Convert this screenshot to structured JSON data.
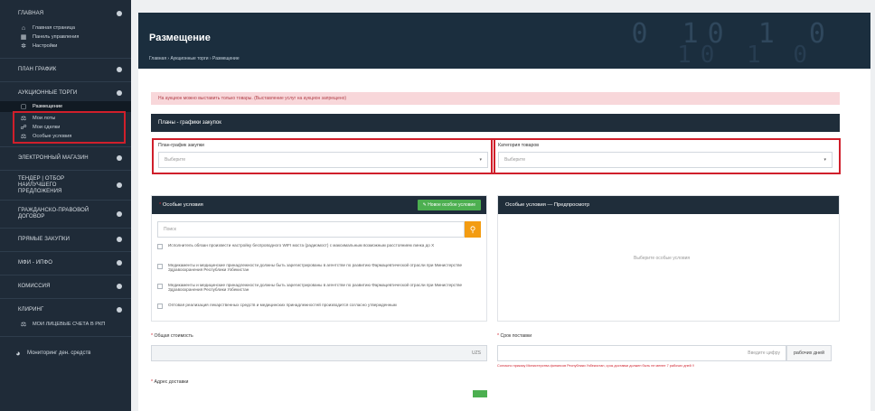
{
  "sidebar": {
    "sections": [
      {
        "title": "ГЛАВНАЯ",
        "items": [
          {
            "label": "Главная страница",
            "icon": "home-icon"
          },
          {
            "label": "Панель управления",
            "icon": "dashboard-icon"
          },
          {
            "label": "Настройки",
            "icon": "gear-icon"
          }
        ]
      },
      {
        "title": "ПЛАН ГРАФИК",
        "items": []
      },
      {
        "title": "АУКЦИОННЫЕ ТОРГИ",
        "items": [
          {
            "label": "Размещение",
            "icon": "document-icon"
          },
          {
            "label": "Мои лоты",
            "icon": "gavel-icon"
          },
          {
            "label": "Мои сделки",
            "icon": "handshake-icon"
          },
          {
            "label": "Особые условия",
            "icon": "gavel-icon"
          }
        ]
      },
      {
        "title": "ЭЛЕКТРОННЫЙ МАГАЗИН",
        "items": []
      },
      {
        "title": "ТЕНДЕР | ОТБОР НАИЛУЧШЕГО ПРЕДЛОЖЕНИЯ",
        "items": []
      },
      {
        "title": "ГРАЖДАНСКО-ПРАВОВОЙ ДОГОВОР",
        "items": []
      },
      {
        "title": "ПРЯМЫЕ ЗАКУПКИ",
        "items": []
      },
      {
        "title": "МФИ - ИПФО",
        "items": []
      },
      {
        "title": "КОМИССИЯ",
        "items": []
      },
      {
        "title": "КЛИРИНГ",
        "items": [
          {
            "label": "МОИ ЛИЦЕВЫЕ СЧЕТА В РКП",
            "icon": "gavel-icon"
          }
        ]
      },
      {
        "title": "Мониторинг ден. средств",
        "items": []
      }
    ]
  },
  "header": {
    "title": "Размещение",
    "breadcrumb": "Главная  ›  Аукционные торги  ›  Размещение",
    "deco_top": "0 10 1 0",
    "deco_bottom": "10 1 0"
  },
  "alert": "На аукцион можно выставить только товары. (Выставление услуг на аукцион запрещено)",
  "plans": {
    "heading": "Планы - графики закупок",
    "plan_label": "План-график закупки",
    "plan_placeholder": "Выберите",
    "category_label": "Категория товаров",
    "category_placeholder": "Выберите"
  },
  "conditions": {
    "heading": "Особые условия",
    "new_button": "Новое особое условие",
    "search_placeholder": "Поиск",
    "items": [
      "Исполнитель обязан произвести настройку беспроводного WIFI моста (радиомост) с максимальным возможным расстоянием линка до X",
      "Медикаменты и медицинские принадлежности должны быть зарегистрированы в агентстве по развитию Фармацевтической отрасли при Министерстве Здравоохранения Республики Узбекистан",
      "Медикаменты и медицинские принадлежности должны быть зарегистрированы в агентстве по развитию Фармацевтической отрасли при Министерстве Здравоохранения Республики Узбекистан",
      "Оптовая реализация лекарственных средств и медицинских принадлежностей производится согласно утвержденным"
    ],
    "preview_heading": "Особые условия — Предпросмотр",
    "preview_placeholder": "Выберите особые условия"
  },
  "totals": {
    "total_label": "Общая стоимость",
    "currency": "UZS",
    "delivery_label": "Срок поставки",
    "delivery_placeholder": "Введите цифру",
    "unit_button": "рабочих дней",
    "delivery_note": "Согласно приказу Министерства финансов Республики Узбекистан, срок доставки должен быть не менее 7 рабочих дней !!",
    "address_label": "Адрес доставки"
  }
}
